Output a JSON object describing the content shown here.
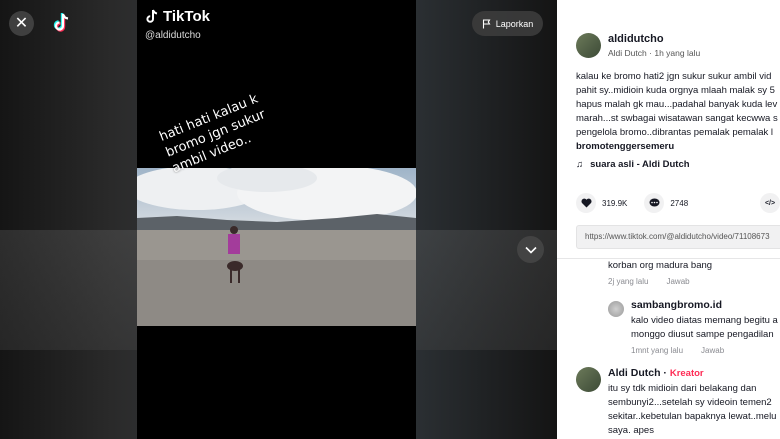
{
  "header": {
    "brand_name": "TikTok",
    "handle": "@aldidutcho",
    "report_label": "Laporkan"
  },
  "video": {
    "overlay_text": "hati hati kalau k bromo jgn sukur ambil video.."
  },
  "author": {
    "username": "aldidutcho",
    "display_name": "Aldi Dutch",
    "separator": "·",
    "time_ago": "1h yang lalu"
  },
  "caption": {
    "lines": [
      "kalau ke bromo hati2 jgn sukur sukur ambil vid",
      "pahit sy..midioin kuda orgnya mlaah malak sy 5",
      "hapus malah gk mau...padahal banyak kuda lev",
      "marah...st swbagai wisatawan sangat kecwwa s",
      "pengelola bromo..dibrantas pemalak pemalak l"
    ],
    "hashtag": "bromotenggersemeru"
  },
  "music": {
    "label": "suara asli - Aldi Dutch"
  },
  "stats": {
    "likes": "319.9K",
    "comments": "2748"
  },
  "share": {
    "embed_label": "</>",
    "url": "https://www.tiktok.com/@aldidutcho/video/71108673"
  },
  "comments": [
    {
      "text": "korban org madura bang",
      "time": "2j yang lalu",
      "reply_label": "Jawab"
    },
    {
      "username": "sambangbromo.id",
      "lines": [
        "kalo video diatas memang begitu a",
        "monggo diusut sampe pengadilan"
      ],
      "time": "1mnt yang lalu",
      "reply_label": "Jawab"
    },
    {
      "username": "Aldi Dutch",
      "separator": "·",
      "badge": "Kreator",
      "lines": [
        "itu sy tdk midioin dari belakang dan",
        "sembunyi2...setelah sy videoin temen2",
        "sekitar..kebetulan bapaknya lewat..melu",
        "saya. apes"
      ]
    }
  ],
  "colors": {
    "creator_badge": "#fe2c55",
    "panel_bg": "#ffffff",
    "video_bg": "#000000"
  }
}
